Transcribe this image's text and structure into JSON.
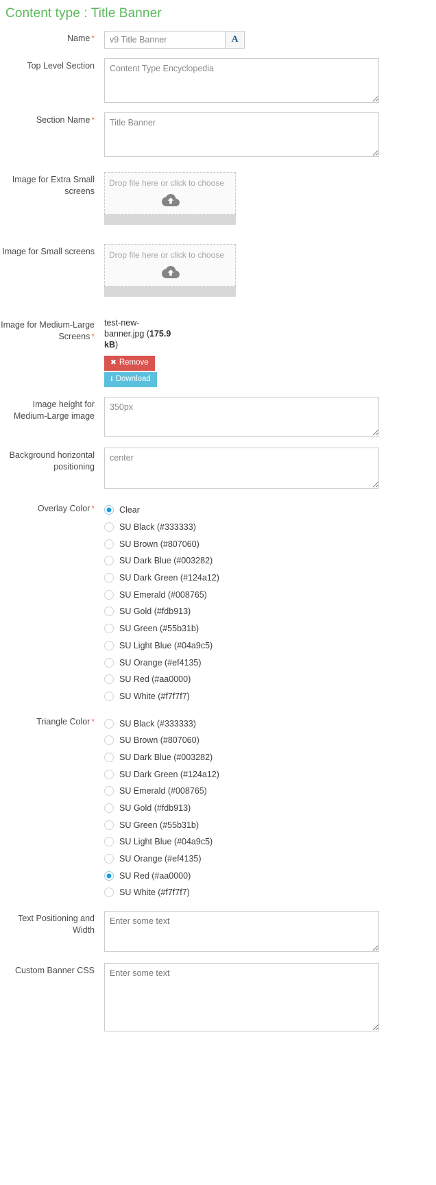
{
  "page": {
    "title": "Content type : Title Banner",
    "title_color": "#5cb85c"
  },
  "fields": {
    "name": {
      "label": "Name",
      "required": true,
      "value": "v9 Title Banner",
      "addon_label": "A"
    },
    "top_level_section": {
      "label": "Top Level Section",
      "required": false,
      "value": "Content Type Encyclopedia"
    },
    "section_name": {
      "label": "Section Name",
      "required": true,
      "value": "Title Banner"
    },
    "image_xs": {
      "label": "Image for Extra Small screens",
      "required": false,
      "dropzone_text": "Drop file here or click to choose",
      "icon": "cloud-upload-icon"
    },
    "image_sm": {
      "label": "Image for Small screens",
      "required": false,
      "dropzone_text": "Drop file here or click to choose",
      "icon": "cloud-upload-icon"
    },
    "image_md_lg": {
      "label": "Image for Medium-Large Screens",
      "required": true,
      "file_name": "test-new-banner.jpg",
      "file_size": "175.9 kB",
      "remove_label": "Remove",
      "download_label": "Download",
      "remove_icon": "x-icon",
      "download_icon": "download-icon",
      "remove_color": "#d9534f",
      "download_color": "#5bc0de"
    },
    "image_height": {
      "label": "Image height for Medium-Large image",
      "required": false,
      "value": "350px"
    },
    "background_horizontal_positioning": {
      "label": "Background horizontal positioning",
      "required": false,
      "value": "center"
    },
    "overlay_color": {
      "label": "Overlay Color",
      "required": true,
      "selected": "Clear",
      "options": [
        "Clear",
        "SU Black (#333333)",
        "SU Brown (#807060)",
        "SU Dark Blue (#003282)",
        "SU Dark Green (#124a12)",
        "SU Emerald (#008765)",
        "SU Gold (#fdb913)",
        "SU Green (#55b31b)",
        "SU Light Blue (#04a9c5)",
        "SU Orange (#ef4135)",
        "SU Red (#aa0000)",
        "SU White (#f7f7f7)"
      ]
    },
    "triangle_color": {
      "label": "Triangle Color",
      "required": true,
      "selected": "SU Red (#aa0000)",
      "options": [
        "SU Black (#333333)",
        "SU Brown (#807060)",
        "SU Dark Blue (#003282)",
        "SU Dark Green (#124a12)",
        "SU Emerald (#008765)",
        "SU Gold (#fdb913)",
        "SU Green (#55b31b)",
        "SU Light Blue (#04a9c5)",
        "SU Orange (#ef4135)",
        "SU Red (#aa0000)",
        "SU White (#f7f7f7)"
      ]
    },
    "text_positioning_width": {
      "label": "Text Positioning and Width",
      "required": false,
      "value": "",
      "placeholder": "Enter some text"
    },
    "custom_banner_css": {
      "label": "Custom Banner CSS",
      "required": false,
      "value": "",
      "placeholder": "Enter some text"
    }
  }
}
